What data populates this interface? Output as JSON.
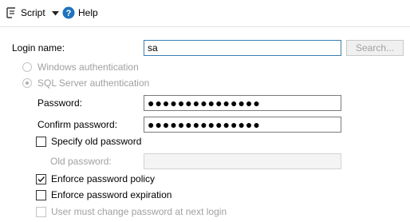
{
  "toolbar": {
    "script_label": "Script",
    "help_label": "Help"
  },
  "login": {
    "label": "Login name:",
    "value": "sa",
    "search_label": "Search..."
  },
  "auth": {
    "windows_label": "Windows authentication",
    "sql_label": "SQL Server authentication"
  },
  "password": {
    "label": "Password:",
    "value": "●●●●●●●●●●●●●●●"
  },
  "confirm": {
    "label": "Confirm password:",
    "value": "●●●●●●●●●●●●●●●"
  },
  "old": {
    "checkbox_label": "Specify old password",
    "label": "Old password:"
  },
  "policy": {
    "enforce_policy_label": "Enforce password policy",
    "enforce_policy_checked": true,
    "enforce_expiration_label": "Enforce password expiration",
    "enforce_expiration_checked": false,
    "must_change_label": "User must change password at next login",
    "must_change_checked": false
  }
}
